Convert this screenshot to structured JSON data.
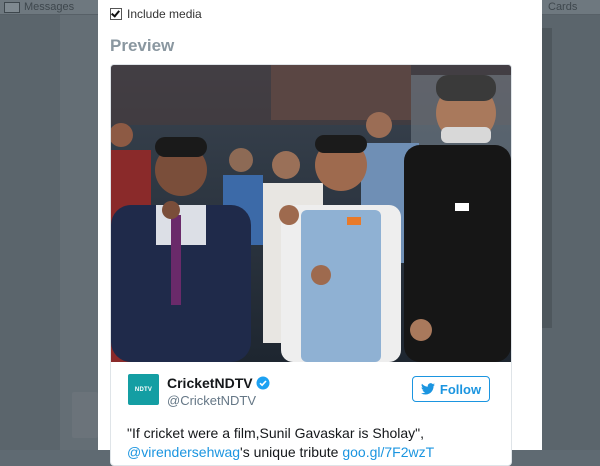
{
  "background": {
    "messages_label": "Messages",
    "right_label": "Cards"
  },
  "modal": {
    "include_media_label": "Include media",
    "include_media_checked": true,
    "preview_heading": "Preview"
  },
  "tweet": {
    "avatar_text": "NDTV",
    "display_name": "CricketNDTV",
    "verified": true,
    "handle": "@CricketNDTV",
    "follow_label": "Follow",
    "text_line1": "\"If cricket were a film,Sunil Gavaskar is Sholay\",",
    "mention": "@virendersehwag",
    "text_mid": "'s unique tribute ",
    "link": "goo.gl/7F2wzT"
  },
  "colors": {
    "accent": "#1b95e0",
    "avatar_bg": "#149ea3",
    "preview_heading": "#8a97a0"
  }
}
